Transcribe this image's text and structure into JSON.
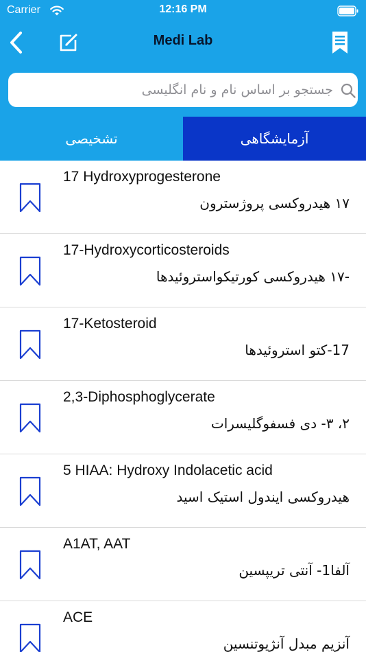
{
  "status_bar": {
    "carrier": "Carrier",
    "time": "12:16 PM"
  },
  "nav": {
    "title": "Medi Lab",
    "back_icon": "chevron-left-icon",
    "edit_icon": "compose-icon",
    "bookmarks_icon": "bookmark-list-icon"
  },
  "search": {
    "placeholder": "جستجو بر اساس نام و نام انگلیسی",
    "value": ""
  },
  "tabs": [
    {
      "label": "تشخیصی",
      "selected": false
    },
    {
      "label": "آزمایشگاهی",
      "selected": true
    }
  ],
  "items": [
    {
      "en": "17 Hydroxyprogesterone",
      "fa": "۱۷ هیدروکسی پروژسترون"
    },
    {
      "en": "17-Hydroxycorticosteroids",
      "fa": "-۱۷ هیدروکسی کورتیکواستروئیدها"
    },
    {
      "en": "17-Ketosteroid",
      "fa": "17-کتو استروئیدها"
    },
    {
      "en": "2,3-Diphosphoglycerate",
      "fa": "۲، ۳- دی فسفوگلیسرات"
    },
    {
      "en": "5 HIAA: Hydroxy Indolacetic acid",
      "fa": "هیدروکسی ایندول استیک اسید"
    },
    {
      "en": "A1AT, AAT",
      "fa": "آلفا1- آنتی تریپسین"
    },
    {
      "en": "ACE",
      "fa": "آنزیم مبدل آنژیوتنسین"
    }
  ],
  "colors": {
    "header": "#1aa3e8",
    "tab_selected": "#0a36c8",
    "icon_blue": "#1b3fd1",
    "title": "#08152b"
  }
}
